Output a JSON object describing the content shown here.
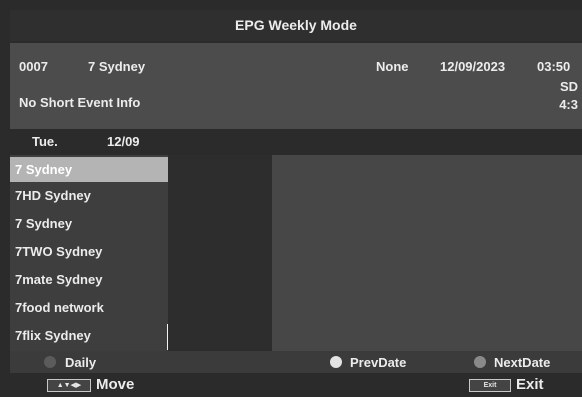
{
  "header": {
    "title": "EPG Weekly Mode"
  },
  "info": {
    "channel_number": "0007",
    "channel_name": "7 Sydney",
    "event": "None",
    "date": "12/09/2023",
    "time": "03:50",
    "description": "No Short Event Info",
    "format": "SD",
    "aspect": "4:3"
  },
  "date_bar": {
    "day": "Tue.",
    "date": "12/09"
  },
  "channels": [
    {
      "label": "7 Sydney",
      "selected": true
    },
    {
      "label": "7HD Sydney",
      "selected": false
    },
    {
      "label": "7 Sydney",
      "selected": false
    },
    {
      "label": "7TWO Sydney",
      "selected": false
    },
    {
      "label": "7mate Sydney",
      "selected": false
    },
    {
      "label": "7food network",
      "selected": false
    },
    {
      "label": "7flix Sydney",
      "selected": false
    }
  ],
  "keys": {
    "daily": {
      "label": "Daily",
      "color": "#5b5b5b"
    },
    "prev": {
      "label": "PrevDate",
      "color": "#e3e3e3"
    },
    "next": {
      "label": "NextDate",
      "color": "#8a8a8a"
    }
  },
  "nav": {
    "arrows_icon": "▲▼◀▶",
    "move_label": "Move",
    "exit_key": "Exit",
    "exit_label": "Exit"
  },
  "colors": {
    "selection": "#b4b4b4",
    "info_panel": "#4c4c4c",
    "event_panel": "#474747"
  }
}
